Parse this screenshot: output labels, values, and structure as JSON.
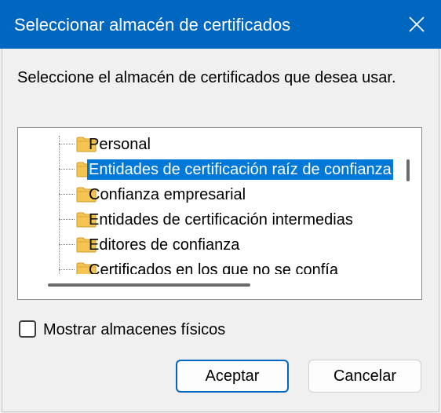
{
  "window": {
    "title": "Seleccionar almacén de certificados",
    "close_icon": "close-icon"
  },
  "prompt": "Seleccione el almacén de certificados que desea usar.",
  "tree": {
    "items": [
      {
        "label": "Personal",
        "selected": false
      },
      {
        "label": "Entidades de certificación raíz de confianza",
        "selected": true
      },
      {
        "label": "Confianza empresarial",
        "selected": false
      },
      {
        "label": "Entidades de certificación intermedias",
        "selected": false
      },
      {
        "label": "Editores de confianza",
        "selected": false
      },
      {
        "label": "Certificados en los que no se confía",
        "selected": false
      }
    ]
  },
  "checkbox": {
    "label": "Mostrar almacenes físicos",
    "checked": false
  },
  "buttons": {
    "ok": "Aceptar",
    "cancel": "Cancelar"
  },
  "colors": {
    "titlebar": "#0067c0",
    "selection": "#0078d7",
    "folder": "#f4c551"
  }
}
